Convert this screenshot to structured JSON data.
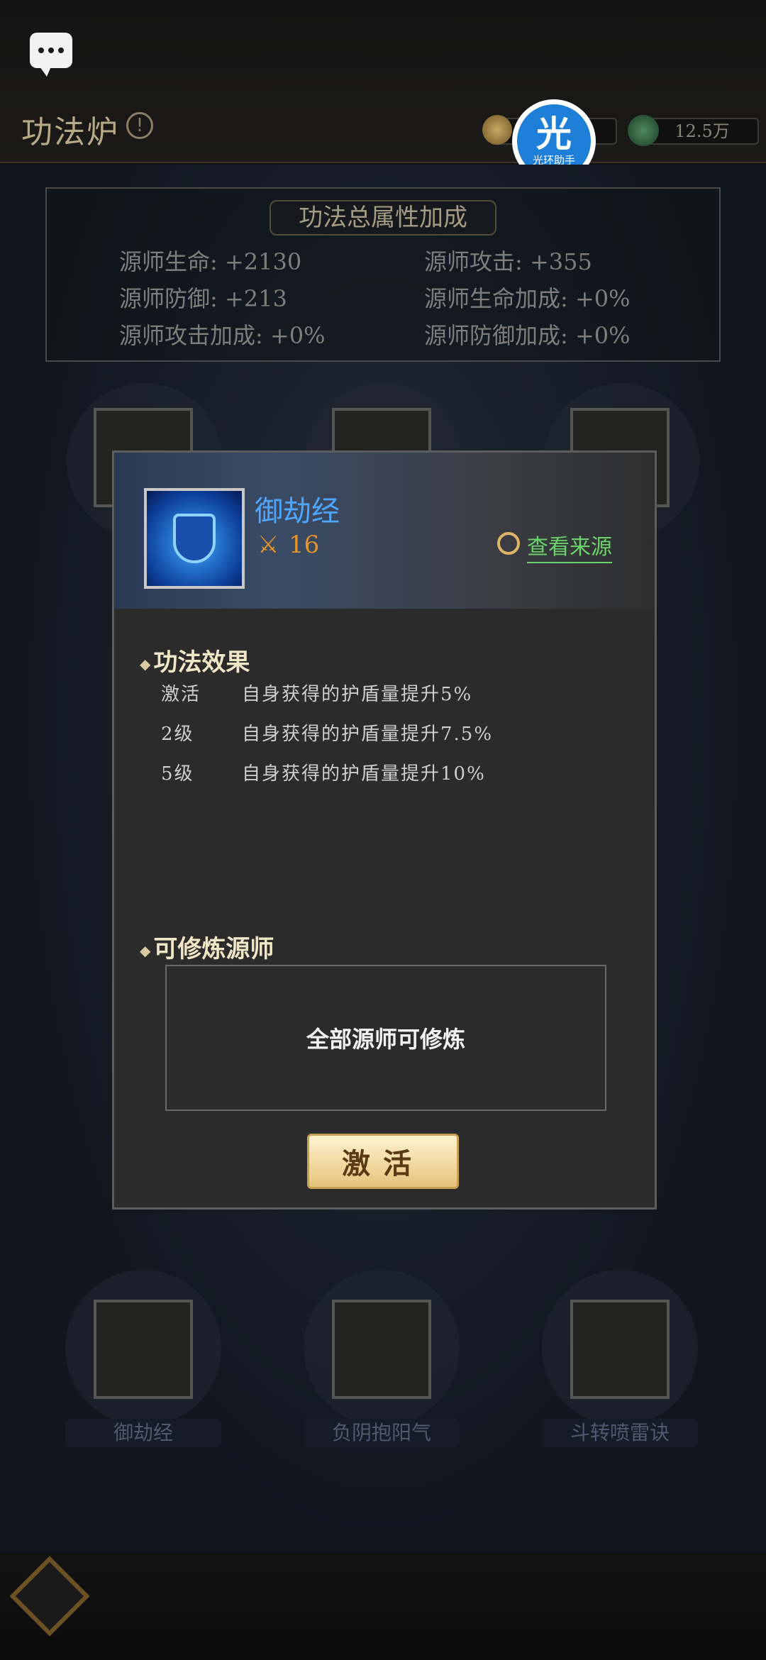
{
  "header": {
    "title": "功法炉",
    "info_icon": "info-icon",
    "resource_currency_2": "12.5万",
    "badge_char": "光",
    "badge_text": "光环助手"
  },
  "attributes": {
    "panel_title": "功法总属性加成",
    "items": [
      "源师生命: +2130",
      "源师攻击: +355",
      "源师防御: +213",
      "源师生命加成: +0%",
      "源师攻击加成: +0%",
      "源师防御加成: +0%"
    ]
  },
  "grid_labels": {
    "row4": [
      "御劫经",
      "负阴抱阳气",
      "斗转喷雷诀"
    ]
  },
  "modal": {
    "skill_name": "御劫经",
    "skill_level": "16",
    "source_link": "查看来源",
    "effects_title": "功法效果",
    "effects": [
      {
        "level": "激活",
        "desc": "自身获得的护盾量提升5%"
      },
      {
        "level": "2级",
        "desc": "自身获得的护盾量提升7.5%"
      },
      {
        "level": "5级",
        "desc": "自身获得的护盾量提升10%"
      }
    ],
    "trainable_title": "可修炼源师",
    "trainable_text": "全部源师可修炼",
    "activate_button": "激活"
  },
  "colors": {
    "skill_name": "#4fa6ff",
    "source_link": "#69d46a",
    "level": "#e3942a"
  }
}
